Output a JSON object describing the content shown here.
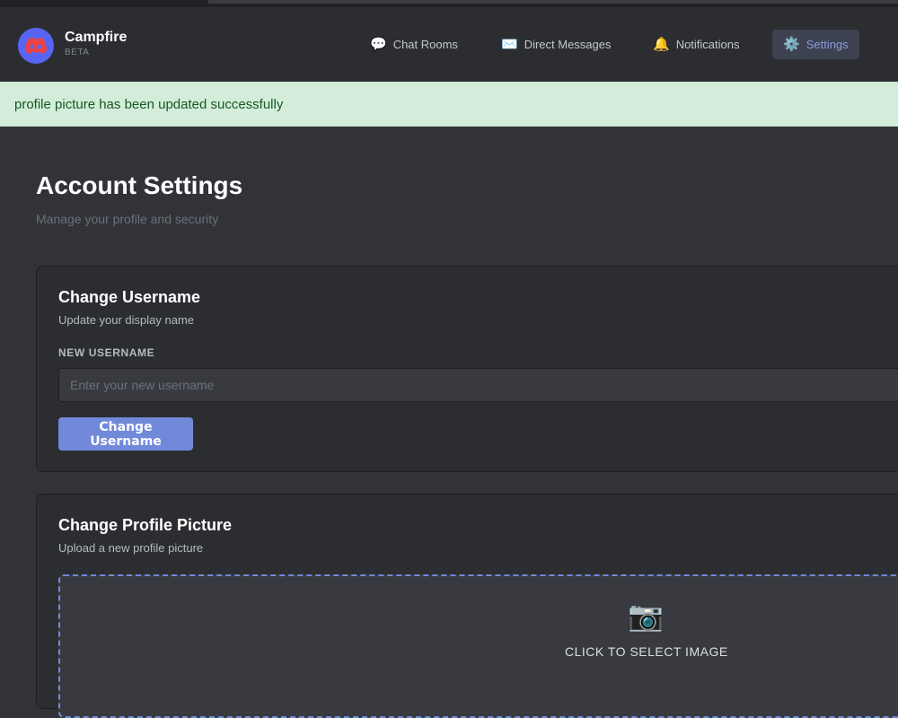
{
  "app": {
    "name": "Campfire",
    "tag": "BETA",
    "logo_icon": "discord-icon",
    "accent": "#5865f2"
  },
  "nav": [
    {
      "label": "Chat Rooms",
      "icon": "speech-bubble-icon",
      "glyph": "💬",
      "active": false
    },
    {
      "label": "Direct Messages",
      "icon": "envelope-icon",
      "glyph": "✉️",
      "active": false
    },
    {
      "label": "Notifications",
      "icon": "bell-icon",
      "glyph": "🔔",
      "active": false
    },
    {
      "label": "Settings",
      "icon": "gear-icon",
      "glyph": "⚙️",
      "active": true
    }
  ],
  "alert": {
    "message": "profile picture has been updated successfully",
    "type": "success",
    "bg": "#d4edda",
    "color": "#155724"
  },
  "page": {
    "title": "Account Settings",
    "subtitle": "Manage your profile and security"
  },
  "username_card": {
    "title": "Change Username",
    "description": "Update your display name",
    "field_label": "NEW USERNAME",
    "input_value": "",
    "input_placeholder": "Enter your new username",
    "button_label": "Change Username",
    "button_color": "#7289da"
  },
  "picture_card": {
    "title": "Change Profile Picture",
    "description": "Upload a new profile picture",
    "dropzone_icon": "camera-icon",
    "dropzone_glyph": "📷",
    "dropzone_label": "CLICK TO SELECT IMAGE"
  }
}
